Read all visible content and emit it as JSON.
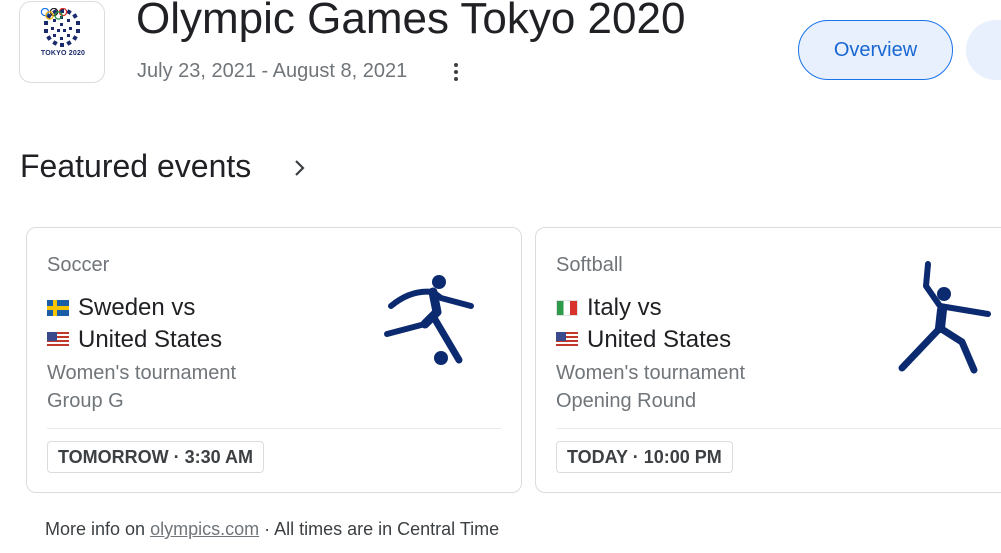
{
  "header": {
    "logo_text": "TOKYO 2020",
    "title": "Olympic Games Tokyo 2020",
    "dates": "July 23, 2021 - August 8, 2021",
    "icons": {
      "more": "more-vert-icon"
    }
  },
  "tabs": [
    {
      "label": "Overview",
      "selected": true
    },
    {
      "label": "",
      "selected": false
    }
  ],
  "featured": {
    "title": "Featured events",
    "icon": "chevron-right-icon",
    "events": [
      {
        "sport": "Soccer",
        "team1": "Sweden vs",
        "team1_flag": "sweden-flag-icon",
        "team2": "United States",
        "team2_flag": "us-flag-icon",
        "desc1": "Women's tournament",
        "desc2": "Group G",
        "time": "TOMORROW · 3:30 AM",
        "pictogram": "soccer-pictogram-icon"
      },
      {
        "sport": "Softball",
        "team1": "Italy vs",
        "team1_flag": "italy-flag-icon",
        "team2": "United States",
        "team2_flag": "us-flag-icon",
        "desc1": "Women's tournament",
        "desc2": "Opening Round",
        "time": "TODAY · 10:00 PM",
        "pictogram": "softball-pictogram-icon"
      }
    ]
  },
  "footer": {
    "prefix": "More info on ",
    "link": "olympics.com",
    "suffix": " · All times are in Central Time"
  },
  "colors": {
    "accent": "#1a73e8",
    "chip_bg": "#e8f0fe",
    "pictogram": "#0b2a6f",
    "text_secondary": "#70757a"
  }
}
